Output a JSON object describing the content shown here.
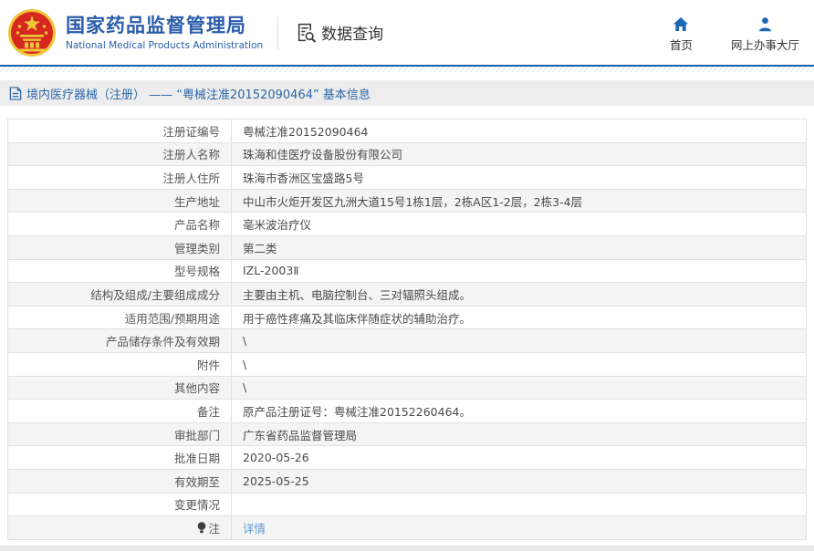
{
  "header": {
    "agency_name_cn": "国家药品监督管理局",
    "agency_name_en": "National Medical Products Administration",
    "data_query_label": "数据查询",
    "nav": [
      {
        "label": "首页",
        "icon": "home-icon"
      },
      {
        "label": "网上办事大厅",
        "icon": "person-icon"
      }
    ]
  },
  "breadcrumb": {
    "text": "境内医疗器械（注册） —— “粤械注准20152090464” 基本信息"
  },
  "detail_table": {
    "rows": [
      {
        "label": "注册证编号",
        "value": "粤械注准20152090464"
      },
      {
        "label": "注册人名称",
        "value": "珠海和佳医疗设备股份有限公司"
      },
      {
        "label": "注册人住所",
        "value": "珠海市香洲区宝盛路5号"
      },
      {
        "label": "生产地址",
        "value": "中山市火炬开发区九洲大道15号1栋1层，2栋A区1-2层，2栋3-4层"
      },
      {
        "label": "产品名称",
        "value": "毫米波治疗仪"
      },
      {
        "label": "管理类别",
        "value": "第二类"
      },
      {
        "label": "型号规格",
        "value": "IZL-2003Ⅱ"
      },
      {
        "label": "结构及组成/主要组成成分",
        "value": "主要由主机、电脑控制台、三对辐照头组成。"
      },
      {
        "label": "适用范围/预期用途",
        "value": "用于癌性疼痛及其临床伴随症状的辅助治疗。"
      },
      {
        "label": "产品储存条件及有效期",
        "value": "\\"
      },
      {
        "label": "附件",
        "value": "\\"
      },
      {
        "label": "其他内容",
        "value": "\\"
      },
      {
        "label": "备注",
        "value": "原产品注册证号：粤械注准20152260464。"
      },
      {
        "label": "审批部门",
        "value": "广东省药品监督管理局"
      },
      {
        "label": "批准日期",
        "value": "2020-05-26"
      },
      {
        "label": "有效期至",
        "value": "2025-05-25"
      },
      {
        "label": "变更情况",
        "value": ""
      },
      {
        "label": "注",
        "value": "详情",
        "label_icon": "note-icon",
        "value_link": true
      }
    ]
  },
  "colors": {
    "brand_blue": "#2a5caa",
    "accent_blue": "#1f66b1",
    "line_blue": "#1560af",
    "link_blue": "#5b9bd5",
    "breadcrumb_bg": "#ededed",
    "row_alt_bg": "#f4f4f4",
    "border": "#e1e1e1",
    "emblem_red": "#d6281e",
    "emblem_gold": "#f0c53a"
  }
}
